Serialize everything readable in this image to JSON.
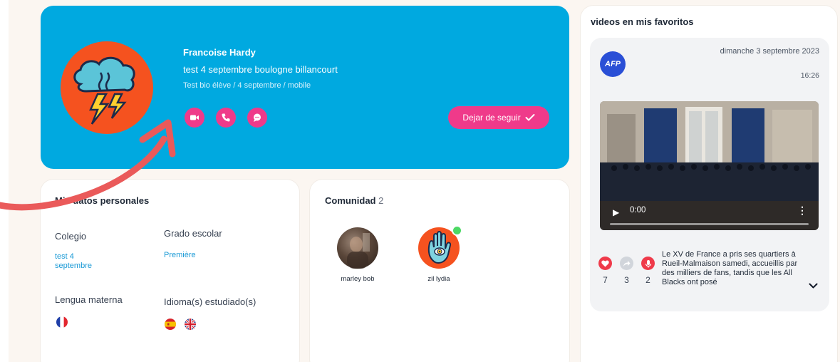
{
  "profile": {
    "name": "Francoise Hardy",
    "line": "test 4 septembre boulogne billancourt",
    "bio": "Test bio élève / 4 septembre / mobile",
    "unfollow_label": "Dejar de seguir",
    "colors": {
      "card": "#00a9e0",
      "accent": "#ef3a8a",
      "avatar_bg": "#f5521f"
    },
    "actions": [
      "video-call-icon",
      "phone-icon",
      "chat-icon"
    ]
  },
  "personal": {
    "title": "Mis datos personales",
    "school_label": "Colegio",
    "school_value": "test 4 septembre",
    "grade_label": "Grado escolar",
    "grade_value": "Première",
    "mother_tongue_label": "Lengua materna",
    "studied_label": "Idioma(s) estudiado(s)",
    "mother_tongue_flags": [
      "french-flag-icon"
    ],
    "studied_flags": [
      "spanish-flag-icon",
      "uk-flag-icon"
    ]
  },
  "community": {
    "title": "Comunidad",
    "count": "2",
    "members": [
      {
        "name": "marley bob",
        "online": false
      },
      {
        "name": "zil lydia",
        "online": true
      }
    ]
  },
  "favorites": {
    "title": "videos en mis favoritos",
    "source": "AFP",
    "date": "dimanche 3 septembre 2023",
    "time": "16:26",
    "video_time": "0:00",
    "reactions": [
      {
        "icon": "heart-icon",
        "count": "7",
        "color": "#ef3a4a"
      },
      {
        "icon": "share-icon",
        "count": "3",
        "color": "#d1d5db"
      },
      {
        "icon": "microphone-icon",
        "count": "2",
        "color": "#ef3a4a"
      }
    ],
    "text": "Le XV de France a pris ses quartiers à Rueil-Malmaison samedi, accueillis par des milliers de fans, tandis que les All Blacks ont posé"
  }
}
